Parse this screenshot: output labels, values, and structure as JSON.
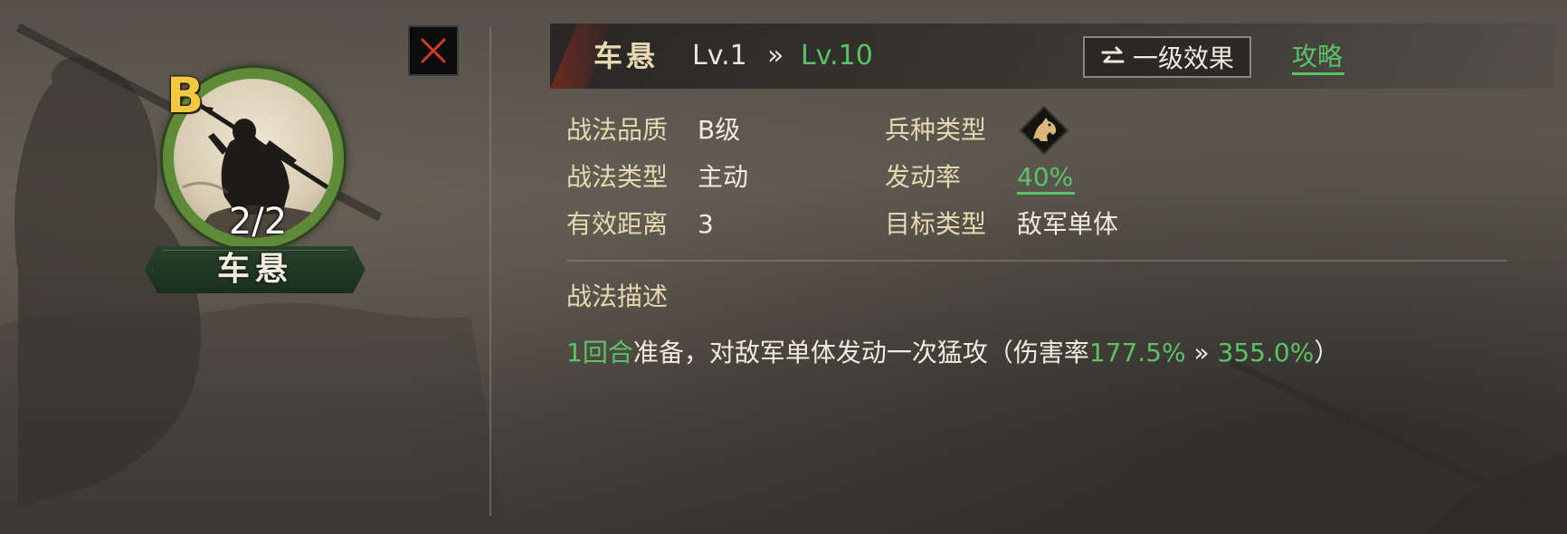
{
  "skill_card": {
    "grade": "B",
    "count": "2/2",
    "name": "车悬"
  },
  "header": {
    "title": "车悬",
    "level_from": "Lv.1",
    "level_arrow": "»",
    "level_to": "Lv.10",
    "effect_button_label": "一级效果",
    "strategy_link": "攻略"
  },
  "attributes": {
    "quality_label": "战法品质",
    "quality_value": "B级",
    "type_label": "战法类型",
    "type_value": "主动",
    "range_label": "有效距离",
    "range_value": "3",
    "troop_label": "兵种类型",
    "troop_icon": "cavalry-horse-icon",
    "rate_label": "发动率",
    "rate_value": "40%",
    "target_label": "目标类型",
    "target_value": "敌军单体"
  },
  "description": {
    "title": "战法描述",
    "prep": "1回合",
    "text_a": "准备，对敌军单体发动一次猛攻（伤害率",
    "dmg_from": "177.5%",
    "arrow": " » ",
    "dmg_to": "355.0%",
    "text_b": "）"
  },
  "colors": {
    "highlight_green": "#5cc16a",
    "label_gold": "#e8d7b3",
    "grade_yellow": "#f2c744",
    "close_red": "#d23a2c"
  }
}
